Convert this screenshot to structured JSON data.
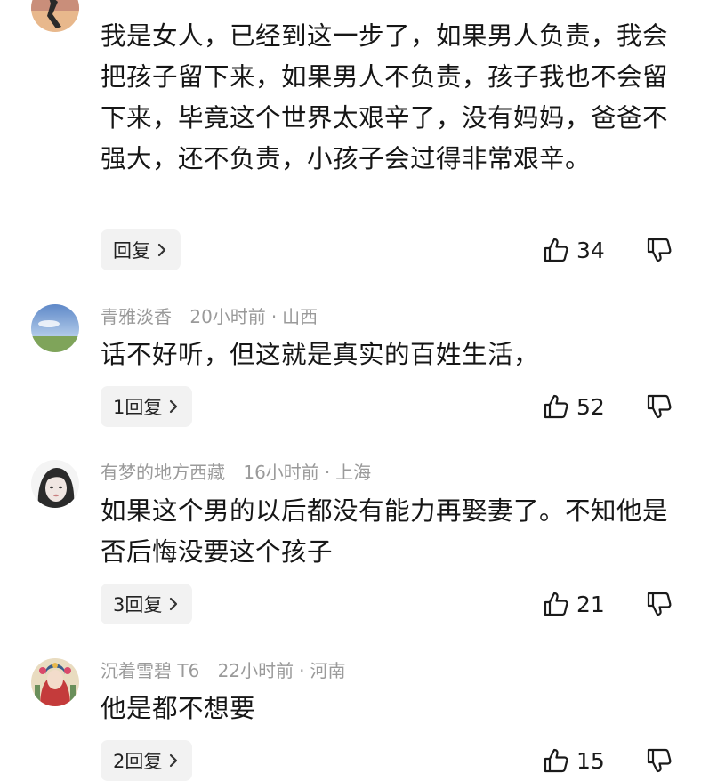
{
  "comments": [
    {
      "author": "",
      "time": "",
      "location": "",
      "text": "我是女人，已经到这一步了，如果男人负责，我会把孩子留下来，如果男人不负责，孩子我也不会留下来，毕竟这个世界太艰辛了，没有妈妈，爸爸不强大，还不负责，小孩子会过得非常艰辛。",
      "reply_label": "回复",
      "likes": "34"
    },
    {
      "author": "青雅淡香",
      "time": "20小时前",
      "location": "山西",
      "text": "话不好听，但这就是真实的百姓生活，",
      "reply_label": "1回复",
      "likes": "52"
    },
    {
      "author": "有梦的地方西藏",
      "time": "16小时前",
      "location": "上海",
      "text": "如果这个男的以后都没有能力再娶妻了。不知他是否后悔没要这个孩子",
      "reply_label": "3回复",
      "likes": "21"
    },
    {
      "author": "沉着雪碧 T6",
      "time": "22小时前",
      "location": "河南",
      "text": "他是都不想要",
      "reply_label": "2回复",
      "likes": "15"
    }
  ],
  "meta_separator": "·",
  "icons": {
    "like": "thumb-up-icon",
    "dislike": "thumb-down-icon",
    "chevron": "chevron-right-icon"
  },
  "colors": {
    "meta_text": "#9a9a9a",
    "reply_bg": "#f2f2f2",
    "body_text": "#161616"
  }
}
